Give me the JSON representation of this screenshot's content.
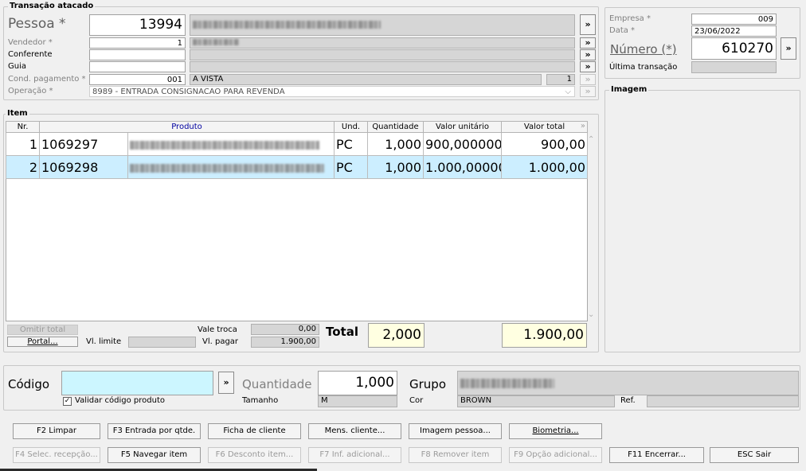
{
  "transacao": {
    "legend": "Transação atacado",
    "pessoa_label": "Pessoa *",
    "pessoa_code": "13994",
    "vendedor_label": "Vendedor *",
    "vendedor_code": "1",
    "conferente_label": "Conferente",
    "guia_label": "Guia",
    "cond_pagamento_label": "Cond. pagamento *",
    "cond_pagamento_code": "001",
    "cond_pagamento_desc": "A VISTA",
    "cond_pagamento_parcelas": "1",
    "operacao_label": "Operação *",
    "operacao_value": "8989 - ENTRADA CONSIGNACAO PARA REVENDA",
    "arrow_label": "»"
  },
  "header_right": {
    "empresa_label": "Empresa *",
    "empresa_value": "009",
    "data_label": "Data *",
    "data_value": "23/06/2022",
    "numero_label": "Número (*)",
    "numero_value": "610270",
    "ultima_label": "Última transação",
    "arrow_label": "»"
  },
  "imagem": {
    "legend": "Imagem"
  },
  "item": {
    "legend": "Item",
    "columns": [
      "Nr.",
      "Produto",
      "Und.",
      "Quantidade",
      "Valor unitário",
      "Valor total"
    ],
    "rows": [
      {
        "nr": "1",
        "code": "1069297",
        "und": "PC",
        "qtd": "1,000",
        "unit": "900,000000",
        "total": "900,00"
      },
      {
        "nr": "2",
        "code": "1069298",
        "und": "PC",
        "qtd": "1,000",
        "unit": "1.000,00000",
        "total": "1.000,00"
      }
    ]
  },
  "totals": {
    "omitir_total": "Omitir total",
    "portal": "Portal...",
    "vl_limite_label": "Vl. limite",
    "vale_troca_label": "Vale troca",
    "vale_troca_value": "0,00",
    "vl_pagar_label": "Vl. pagar",
    "vl_pagar_value": "1.900,00",
    "total_label": "Total",
    "total_qtd": "2,000",
    "total_value": "1.900,00"
  },
  "entry": {
    "codigo_label": "Código",
    "codigo_value": "",
    "arrow_label": "»",
    "validar_label": "Validar código produto",
    "validar_checked": "✓",
    "quantidade_label": "Quantidade",
    "quantidade_value": "1,000",
    "tamanho_label": "Tamanho",
    "tamanho_value": "M",
    "grupo_label": "Grupo",
    "cor_label": "Cor",
    "cor_value": "BROWN",
    "ref_label": "Ref."
  },
  "buttons_row1": [
    "F2 Limpar",
    "F3 Entrada por qtde.",
    "Ficha de cliente",
    "Mens. cliente...",
    "Imagem pessoa...",
    "Biometria..."
  ],
  "buttons_row2": [
    "F4 Selec. recepção...",
    "F5 Navegar item",
    "F6 Desconto item...",
    "F7 Inf. adicional...",
    "F8 Remover item",
    "F9 Opção adicional...",
    "F11 Encerrar...",
    "ESC Sair"
  ],
  "colors": {
    "selected_row": "#cceeff",
    "highlight_field": "#ffffe1",
    "codigo_field": "#ccf6ff"
  }
}
